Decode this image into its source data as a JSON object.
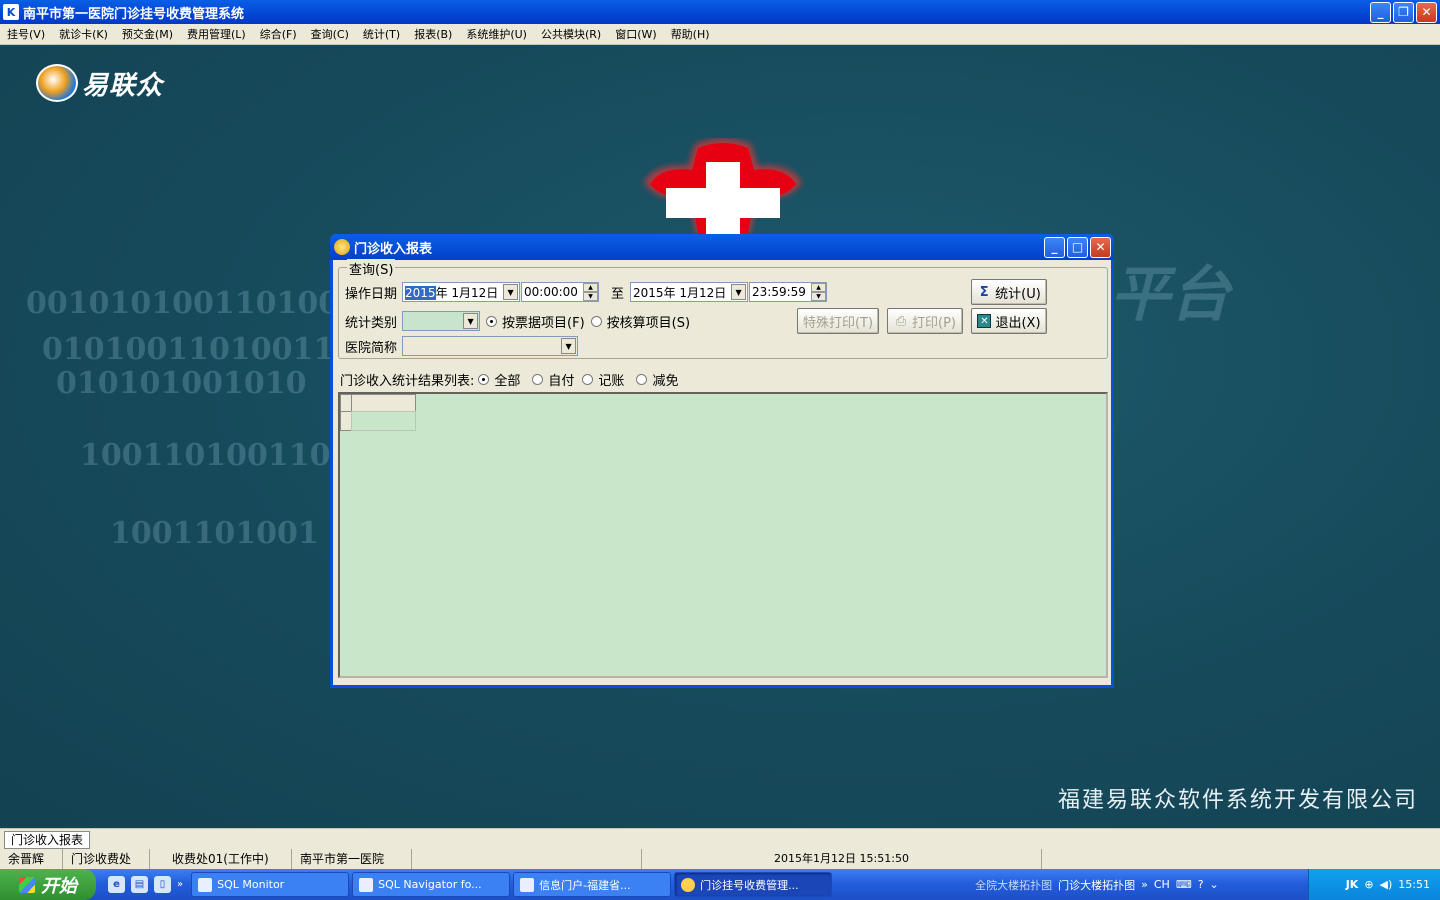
{
  "app": {
    "title": "南平市第一医院门诊挂号收费管理系统",
    "icon_label": "K"
  },
  "menu": [
    "挂号(V)",
    "就诊卡(K)",
    "预交金(M)",
    "费用管理(L)",
    "综合(F)",
    "查询(C)",
    "统计(T)",
    "报表(B)",
    "系统维护(U)",
    "公共模块(R)",
    "窗口(W)",
    "帮助(H)"
  ],
  "desktop": {
    "logo_text": "易联众",
    "company": "福建易联众软件系统开发有限公司",
    "binary_lines": [
      "0010101001101001",
      "010100110100110",
      "010101001010",
      "100110100110",
      "1001101001"
    ],
    "bg_text": "平台"
  },
  "dialog": {
    "title": "门诊收入报表",
    "group_label": "查询(S)",
    "op_date_label": "操作日期",
    "start_date_year": "2015",
    "start_date_rest": "年 1月12日",
    "start_time": "00:00:00",
    "to_label": "至",
    "end_date": "2015年 1月12日",
    "end_time": "23:59:59",
    "stat_type_label": "统计类别",
    "radio_invoice": "按票据项目(F)",
    "radio_accounting": "按核算项目(S)",
    "hospital_label": "医院简称",
    "btn_stat": "统计(U)",
    "btn_special_print": "特殊打印(T)",
    "btn_print": "打印(P)",
    "btn_exit": "退出(X)",
    "result_label": "门诊收入统计结果列表:",
    "filter_all": "全部",
    "filter_self": "自付",
    "filter_account": "记账",
    "filter_exempt": "减免"
  },
  "mdi_tab": "门诊收入报表",
  "status": {
    "user": "余晋辉",
    "dept": "门诊收费处",
    "window": "收费处01(工作中)",
    "hospital": "南平市第一医院",
    "datetime": "2015年1月12日  15:51:50"
  },
  "taskbar": {
    "start": "开始",
    "tasks": [
      "SQL Monitor",
      "SQL Navigator fo...",
      "信息门户-福建省...",
      "门诊挂号收费管理..."
    ],
    "tray_text_1": "全院大楼拓扑图",
    "tray_text_2": "门诊大楼拓扑图",
    "lang": "CH",
    "clock": "15:51"
  }
}
